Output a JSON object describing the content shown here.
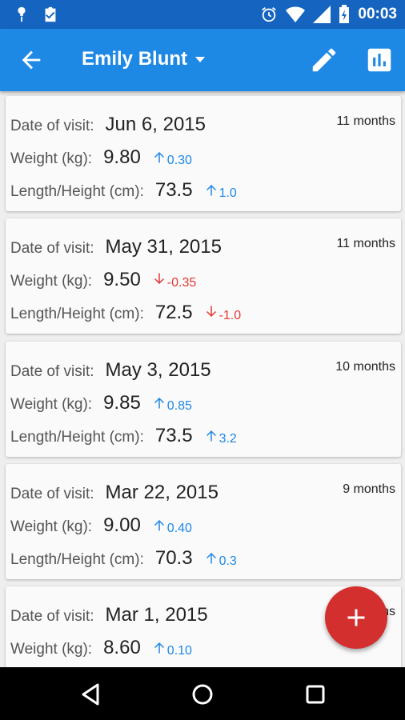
{
  "status_bar": {
    "time": "00:03"
  },
  "app_bar": {
    "title": "Emily Blunt"
  },
  "labels": {
    "date": "Date of visit:",
    "weight": "Weight (kg):",
    "length": "Length/Height (cm):"
  },
  "visits": [
    {
      "date": "Jun 6, 2015",
      "age": "11 months",
      "weight": "9.80",
      "weight_delta": "0.30",
      "weight_dir": "up",
      "length": "73.5",
      "length_delta": "1.0",
      "length_dir": "up"
    },
    {
      "date": "May 31, 2015",
      "age": "11 months",
      "weight": "9.50",
      "weight_delta": "-0.35",
      "weight_dir": "down",
      "length": "72.5",
      "length_delta": "-1.0",
      "length_dir": "down"
    },
    {
      "date": "May 3, 2015",
      "age": "10 months",
      "weight": "9.85",
      "weight_delta": "0.85",
      "weight_dir": "up",
      "length": "73.5",
      "length_delta": "3.2",
      "length_dir": "up"
    },
    {
      "date": "Mar 22, 2015",
      "age": "9 months",
      "weight": "9.00",
      "weight_delta": "0.40",
      "weight_dir": "up",
      "length": "70.3",
      "length_delta": "0.3",
      "length_dir": "up"
    },
    {
      "date": "Mar 1, 2015",
      "age": "8 months",
      "weight": "8.60",
      "weight_delta": "0.10",
      "weight_dir": "up",
      "length": "",
      "length_delta": "",
      "length_dir": "up"
    }
  ],
  "colors": {
    "primary": "#1e88e5",
    "primary_dark": "#1565c0",
    "accent": "#d32f2f",
    "increase": "#1e88e5",
    "decrease": "#e53935"
  },
  "icons": [
    "back-arrow-icon",
    "dropdown-icon",
    "edit-pencil-icon",
    "bar-chart-icon",
    "add-icon",
    "nav-back-icon",
    "nav-home-icon",
    "nav-recents-icon"
  ]
}
